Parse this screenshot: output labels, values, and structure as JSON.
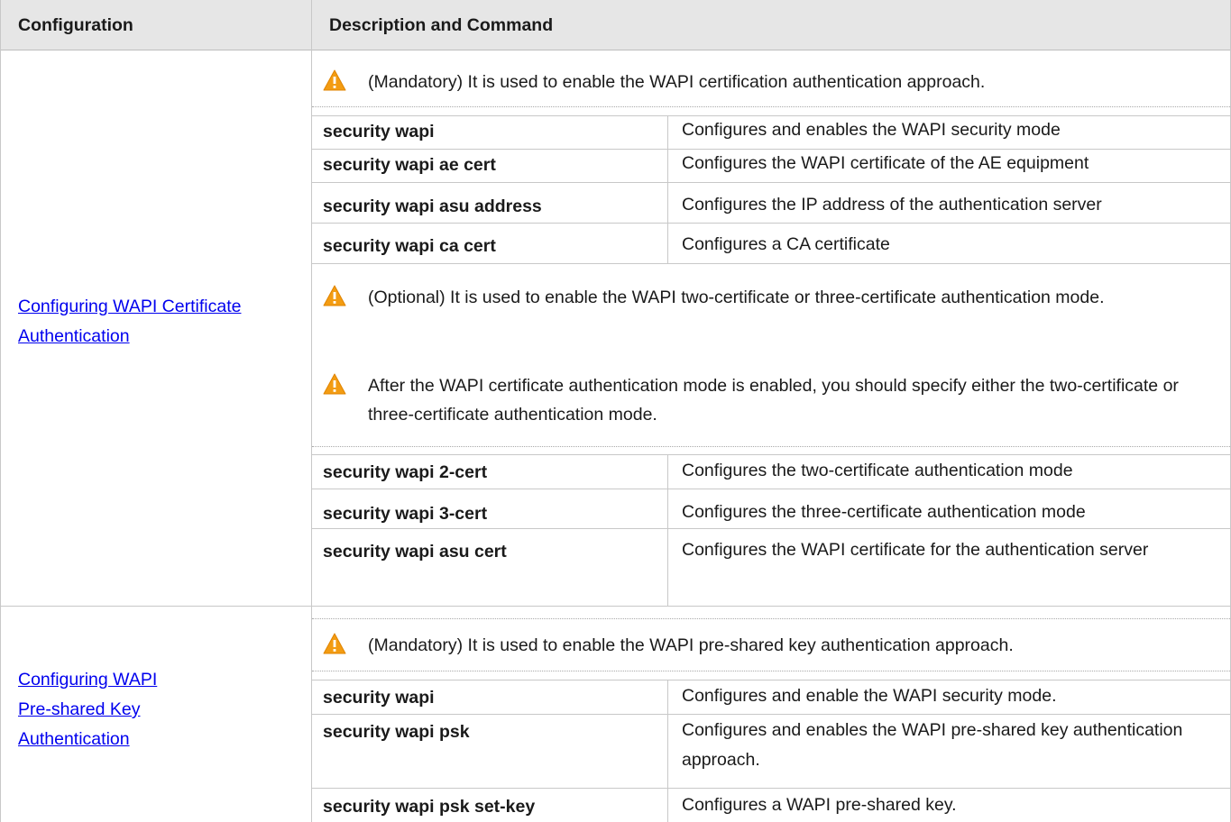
{
  "header": {
    "col1": "Configuration",
    "col2": "Description and Command"
  },
  "sections": [
    {
      "link_lines": [
        "Configuring WAPI Certificate",
        "Authentication"
      ],
      "note1": "(Mandatory) It is used to enable the WAPI certification authentication approach.",
      "rows1": [
        {
          "cmd": "security wapi",
          "desc": "Configures and enables the WAPI security mode"
        },
        {
          "cmd": "security wapi ae cert",
          "desc": "Configures the WAPI certificate of the AE equipment"
        },
        {
          "cmd": "security wapi asu address",
          "desc": "Configures the IP address of the authentication server"
        },
        {
          "cmd": "security wapi ca cert",
          "desc": "Configures a CA certificate"
        }
      ],
      "note2": "(Optional) It is used to enable the WAPI two-certificate or three-certificate authentication mode.",
      "note3": "After the WAPI certificate authentication mode is enabled, you should specify either the two-certificate or three-certificate authentication mode.",
      "rows2": [
        {
          "cmd": "security wapi 2-cert",
          "desc": "Configures the two-certificate authentication mode"
        },
        {
          "cmd": "security wapi 3-cert",
          "desc": "Configures the three-certificate authentication mode"
        },
        {
          "cmd": "security wapi asu cert",
          "desc": "Configures the WAPI certificate for the authentication server"
        }
      ]
    },
    {
      "link_lines": [
        "Configuring WAPI",
        "Pre-shared Key",
        "Authentication"
      ],
      "note1": "(Mandatory) It is used to enable the WAPI pre-shared key authentication approach.",
      "rows1": [
        {
          "cmd": "security wapi",
          "desc": "Configures and enable the WAPI security mode."
        },
        {
          "cmd": "security wapi psk",
          "desc": "Configures and enables the WAPI pre-shared key authentication approach."
        },
        {
          "cmd": "security wapi psk set-key",
          "desc": "Configures a WAPI pre-shared key."
        }
      ]
    }
  ],
  "icons": {
    "warning": "warning-triangle-icon",
    "warning_color": "#f39c12"
  }
}
